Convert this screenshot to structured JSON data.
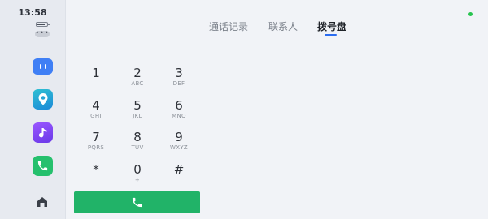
{
  "status": {
    "time": "13:58"
  },
  "sidebar": {
    "more_label": "•••"
  },
  "tabs": [
    {
      "label": "通话记录",
      "active": false
    },
    {
      "label": "联系人",
      "active": false
    },
    {
      "label": "拨号盘",
      "active": true
    }
  ],
  "dialpad": {
    "keys": [
      {
        "digit": "1",
        "letters": ""
      },
      {
        "digit": "2",
        "letters": "ABC"
      },
      {
        "digit": "3",
        "letters": "DEF"
      },
      {
        "digit": "4",
        "letters": "GHI"
      },
      {
        "digit": "5",
        "letters": "JKL"
      },
      {
        "digit": "6",
        "letters": "MNO"
      },
      {
        "digit": "7",
        "letters": "PQRS"
      },
      {
        "digit": "8",
        "letters": "TUV"
      },
      {
        "digit": "9",
        "letters": "WXYZ"
      },
      {
        "digit": "*",
        "letters": ""
      },
      {
        "digit": "0",
        "letters": "+"
      },
      {
        "digit": "#",
        "letters": ""
      }
    ]
  },
  "colors": {
    "call_button": "#21b368",
    "active_tab_indicator": "#2c6df0",
    "status_dot": "#27c44f"
  },
  "icons": {
    "call": "phone-icon",
    "home": "home-icon",
    "apps": [
      "app-grid-icon",
      "maps-icon",
      "music-icon",
      "phone-app-icon"
    ]
  }
}
